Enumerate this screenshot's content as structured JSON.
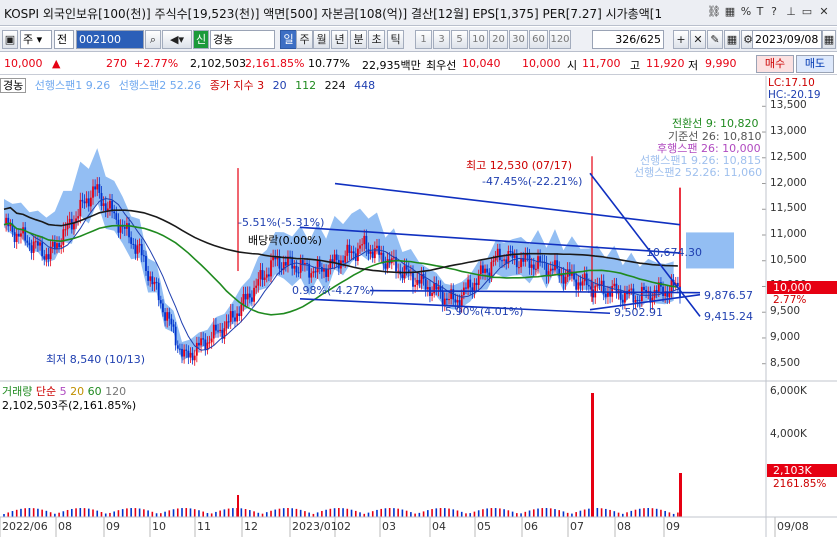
{
  "title_bar": {
    "text": "KOSPI 외국인보유[100(천)] 주식수[19,523(천)] 액면[500] 자본금[108(억)] 결산[12월] EPS[1,375] PER[7.27] 시가총액[1",
    "icons": [
      "link-icon",
      "chart-icon",
      "percent-icon",
      "text-size-icon",
      "thumbtack-icon",
      "help-icon",
      "minimize-icon",
      "maximize-icon",
      "close-icon"
    ]
  },
  "toolbar": {
    "market_label": "주",
    "period_label": "전",
    "code": "002100",
    "credit_label": "신",
    "stock_name": "경농",
    "period_tabs": [
      "일",
      "주",
      "월",
      "년",
      "분",
      "초",
      "틱"
    ],
    "active_period": "일",
    "intervals": [
      "1",
      "3",
      "5",
      "10",
      "20",
      "30",
      "60",
      "120"
    ],
    "page_counter": "326/625",
    "date": "2023/09/08"
  },
  "quote": {
    "price": "10,000",
    "change_arrow": "▲",
    "change": "270",
    "change_pct": "+2.77%",
    "volume": "2,102,503",
    "volume_pct": "2,161.85%",
    "turnover": "10.77%",
    "amount": "22,935백만",
    "priority_sell_label": "최우선",
    "priority_sell": "10,040",
    "priority_buy": "10,000",
    "open_label": "시",
    "open": "11,700",
    "high_label": "고",
    "high": "11,920",
    "low_label": "저",
    "low": "9,990",
    "buy_button": "매수",
    "sell_button": "매도"
  },
  "legend": {
    "stock": "경농",
    "leading1": "선행스팬1 9.26",
    "leading2": "선행스팬2 52.26",
    "close_index": "종가 지수 3",
    "ma20": "20",
    "ma112": "112",
    "ma224": "224",
    "ma448": "448",
    "lc": "LC:17.10",
    "hc": "HC:-20.19"
  },
  "ichimoku_box": {
    "line1": "전환선 9: 10,820",
    "line2": "기준선 26: 10,810",
    "line3": "후행스팬 26: 10,000",
    "line4": "선행스팬1 9.26: 10,815",
    "line5": "선행스팬2 52.26: 11,060"
  },
  "annotations": {
    "high": "최고 12,530 (07/17)",
    "high_pct": "-47.45%(-22.21%)",
    "low": "최저 8,540 (10/13)",
    "dividend": "배당락(0.00%)",
    "pct1": "-5.51%(-5.31%)",
    "pct2": "0.98%(-4.27%)",
    "pct3": "5.90%(4.01%)",
    "trend1": "10,674.30",
    "trend2": "9,876.57",
    "trend3": "9,502.91",
    "trend4": "9,415.24",
    "current_price": "10,000",
    "current_pct": "2.77%"
  },
  "volume_panel": {
    "title": "거래량",
    "simple_label": "단순",
    "ma5": "5",
    "ma20": "20",
    "ma60": "60",
    "ma120": "120",
    "volume_value": "2,102,503주(2,161.85%)",
    "current_label": "2,103K",
    "current_pct": "2161.85%"
  },
  "colors": {
    "up": "#e60012",
    "down": "#0033cc",
    "cloud": "#6fa8ef",
    "ma_black": "#1a1a1a",
    "ma_green": "#1f8a1f",
    "ma_blue": "#1f3fb0"
  },
  "chart_data": {
    "type": "line",
    "title": "",
    "y_ticks": [
      "13,500",
      "13,000",
      "12,500",
      "12,000",
      "11,500",
      "11,000",
      "10,500",
      "10,000",
      "9,500",
      "9,000",
      "8,500"
    ],
    "x_ticks": [
      "2022/06",
      "08",
      "09",
      "10",
      "11",
      "12",
      "2023/01",
      "02",
      "03",
      "04",
      "05",
      "06",
      "07",
      "08",
      "09",
      "09/08"
    ],
    "vol_ticks": [
      "6,000K",
      "4,000K"
    ],
    "ylim": [
      8300,
      13700
    ],
    "series": [
      {
        "name": "",
        "x": [
          "2022/06",
          "2022/07",
          "2022/08",
          "2022/09",
          "2022/10",
          "2022/11",
          "2022/12",
          "2023/01",
          "2023/02",
          "2023/03",
          "2023/04",
          "2023/05",
          "2023/06",
          "2023/07",
          "2023/08",
          "2023/09"
        ],
        "values": [
          11200,
          10600,
          11900,
          10700,
          8600,
          9300,
          10500,
          10300,
          10800,
          10200,
          9700,
          10600,
          10400,
          10000,
          9800,
          10000
        ]
      }
    ]
  }
}
